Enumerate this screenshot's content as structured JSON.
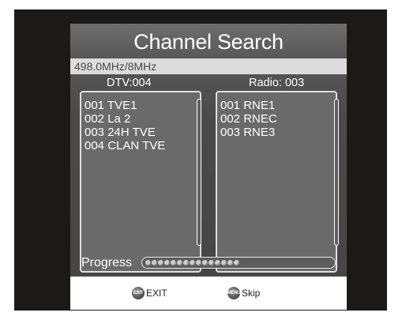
{
  "header": {
    "title": "Channel Search"
  },
  "frequency": {
    "text": "498.0MHz/8MHz"
  },
  "tv": {
    "header": "DTV:004",
    "items": [
      "001 TVE1",
      "002 La 2",
      "003 24H TVE",
      "004 CLAN TVE"
    ]
  },
  "radio": {
    "header": "Radio: 003",
    "items": [
      "001 RNE1",
      "002 RNEC",
      "003 RNE3"
    ]
  },
  "progress": {
    "label": "Progress",
    "value": 0.52
  },
  "footer": {
    "exit": {
      "icon": "exit-key-icon",
      "key_text": "EXIT",
      "label": "EXIT"
    },
    "skip": {
      "icon": "menu-key-icon",
      "key_text": "MENU",
      "label": "Skip"
    }
  }
}
